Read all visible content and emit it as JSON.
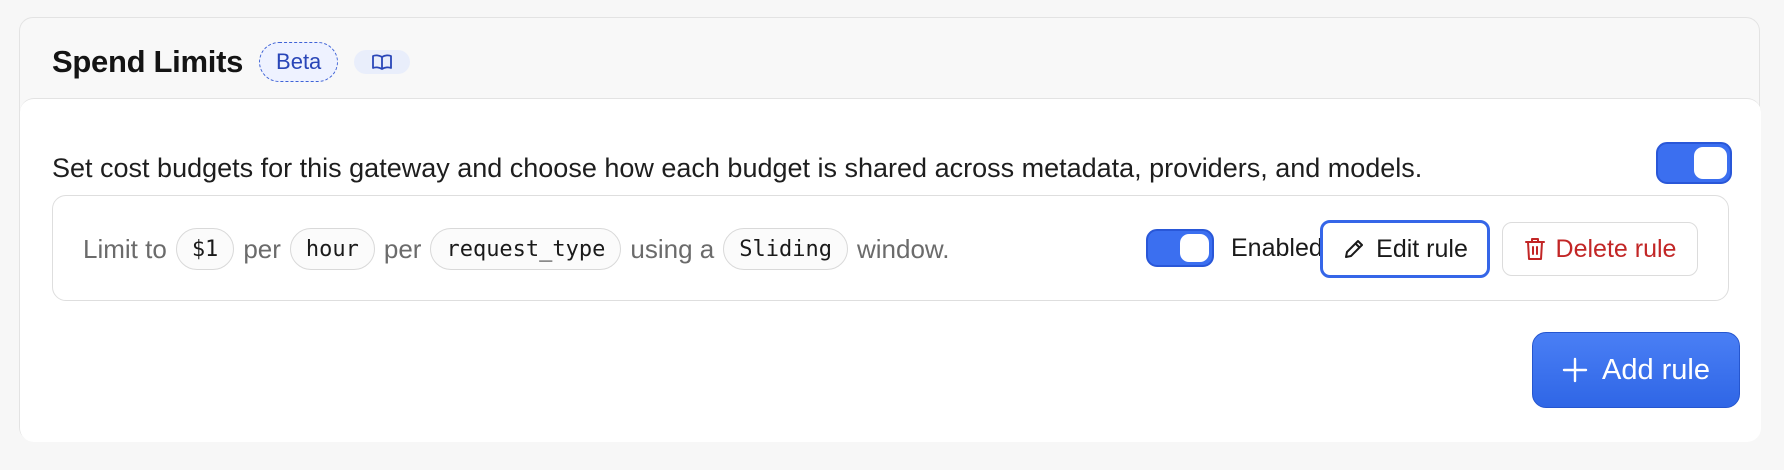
{
  "header": {
    "title": "Spend Limits",
    "beta_badge": "Beta",
    "docs_icon": "book-open-icon"
  },
  "description": "Set cost budgets for this gateway and choose how each budget is shared across metadata, providers, and models.",
  "main_toggle": {
    "state": "on"
  },
  "rule": {
    "prefix": "Limit to",
    "amount": "$1",
    "per1": "per",
    "period": "hour",
    "per2": "per",
    "dimension": "request_type",
    "using": "using a",
    "window_type": "Sliding",
    "suffix": "window.",
    "toggle_state": "on",
    "enabled_label": "Enabled",
    "edit_label": "Edit rule",
    "edit_icon": "pencil-icon",
    "delete_label": "Delete rule",
    "delete_icon": "trash-icon"
  },
  "add_rule": {
    "label": "Add rule",
    "icon": "plus-icon"
  },
  "colors": {
    "accent": "#3b6ff0",
    "danger": "#c22626",
    "beta_text": "#2946b8"
  }
}
